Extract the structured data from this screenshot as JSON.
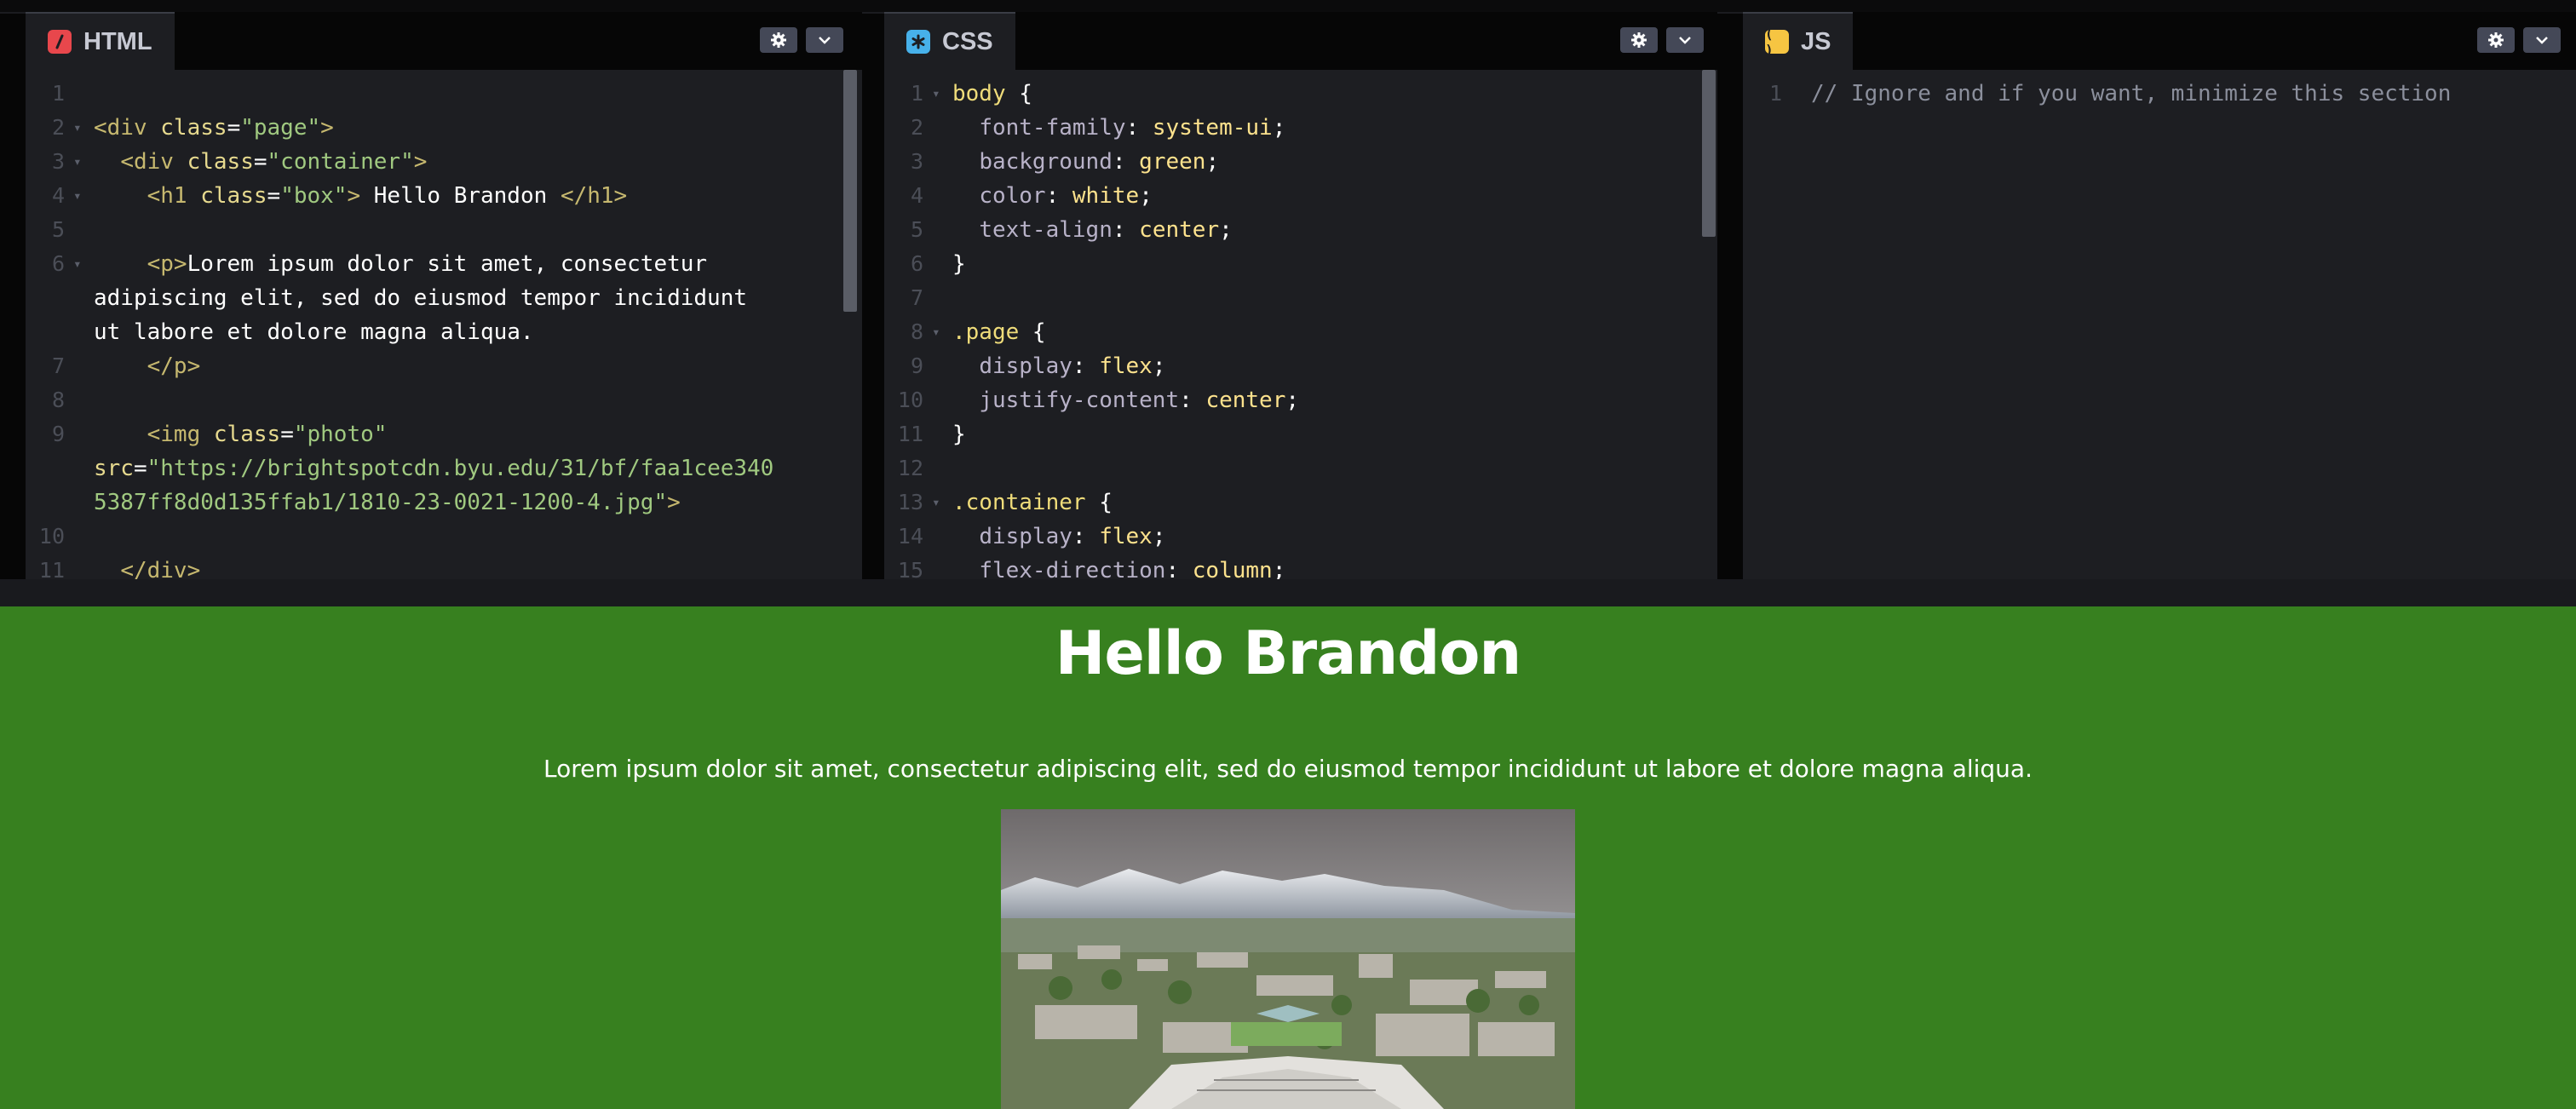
{
  "html_pane": {
    "tab_label": "HTML",
    "icon": "html-slash-icon",
    "lines": [
      {
        "n": "1",
        "fold": false,
        "parts": []
      },
      {
        "n": "2",
        "fold": true,
        "parts": [
          [
            "tag",
            "<div "
          ],
          [
            "attr",
            "class"
          ],
          [
            "punc",
            "="
          ],
          [
            "str",
            "\"page\""
          ],
          [
            "tag",
            ">"
          ]
        ]
      },
      {
        "n": "3",
        "fold": true,
        "parts": [
          [
            "white",
            "  "
          ],
          [
            "tag",
            "<div "
          ],
          [
            "attr",
            "class"
          ],
          [
            "punc",
            "="
          ],
          [
            "str",
            "\"container\""
          ],
          [
            "tag",
            ">"
          ]
        ]
      },
      {
        "n": "4",
        "fold": true,
        "parts": [
          [
            "white",
            "    "
          ],
          [
            "tag",
            "<h1 "
          ],
          [
            "attr",
            "class"
          ],
          [
            "punc",
            "="
          ],
          [
            "str",
            "\"box\""
          ],
          [
            "tag",
            ">"
          ],
          [
            "white",
            " Hello Brandon "
          ],
          [
            "tag",
            "</h1>"
          ]
        ]
      },
      {
        "n": "5",
        "fold": false,
        "parts": []
      },
      {
        "n": "6",
        "fold": true,
        "parts": [
          [
            "white",
            "    "
          ],
          [
            "tag",
            "<p>"
          ],
          [
            "white",
            "Lorem ipsum dolor sit amet, consectetur"
          ]
        ]
      },
      {
        "n": "",
        "fold": false,
        "parts": [
          [
            "white",
            "adipiscing elit, sed do eiusmod tempor incididunt"
          ]
        ]
      },
      {
        "n": "",
        "fold": false,
        "parts": [
          [
            "white",
            "ut labore et dolore magna aliqua."
          ]
        ]
      },
      {
        "n": "7",
        "fold": false,
        "parts": [
          [
            "white",
            "    "
          ],
          [
            "tag",
            "</p>"
          ]
        ]
      },
      {
        "n": "8",
        "fold": false,
        "parts": []
      },
      {
        "n": "9",
        "fold": false,
        "parts": [
          [
            "white",
            "    "
          ],
          [
            "tag",
            "<img "
          ],
          [
            "attr",
            "class"
          ],
          [
            "punc",
            "="
          ],
          [
            "str",
            "\"photo\""
          ]
        ]
      },
      {
        "n": "",
        "fold": false,
        "parts": [
          [
            "attr",
            "src"
          ],
          [
            "punc",
            "="
          ],
          [
            "str",
            "\"https://brightspotcdn.byu.edu/31/bf/faa1cee340"
          ]
        ]
      },
      {
        "n": "",
        "fold": false,
        "parts": [
          [
            "str",
            "5387ff8d0d135ffab1/1810-23-0021-1200-4.jpg\""
          ],
          [
            "tag",
            ">"
          ]
        ]
      },
      {
        "n": "10",
        "fold": false,
        "parts": []
      },
      {
        "n": "11",
        "fold": false,
        "parts": [
          [
            "white",
            "  "
          ],
          [
            "tag",
            "</div>"
          ]
        ]
      }
    ]
  },
  "css_pane": {
    "tab_label": "CSS",
    "icon": "asterisk-icon",
    "lines": [
      {
        "n": "1",
        "fold": true,
        "parts": [
          [
            "sel",
            "body "
          ],
          [
            "punc",
            "{"
          ]
        ]
      },
      {
        "n": "2",
        "fold": false,
        "parts": [
          [
            "white",
            "  "
          ],
          [
            "prop",
            "font-family"
          ],
          [
            "punc",
            ": "
          ],
          [
            "val",
            "system-ui"
          ],
          [
            "punc",
            ";"
          ]
        ]
      },
      {
        "n": "3",
        "fold": false,
        "parts": [
          [
            "white",
            "  "
          ],
          [
            "prop",
            "background"
          ],
          [
            "punc",
            ": "
          ],
          [
            "val",
            "green"
          ],
          [
            "punc",
            ";"
          ]
        ]
      },
      {
        "n": "4",
        "fold": false,
        "parts": [
          [
            "white",
            "  "
          ],
          [
            "prop",
            "color"
          ],
          [
            "punc",
            ": "
          ],
          [
            "val",
            "white"
          ],
          [
            "punc",
            ";"
          ]
        ]
      },
      {
        "n": "5",
        "fold": false,
        "parts": [
          [
            "white",
            "  "
          ],
          [
            "prop",
            "text-align"
          ],
          [
            "punc",
            ": "
          ],
          [
            "val",
            "center"
          ],
          [
            "punc",
            ";"
          ]
        ]
      },
      {
        "n": "6",
        "fold": false,
        "parts": [
          [
            "punc",
            "}"
          ]
        ]
      },
      {
        "n": "7",
        "fold": false,
        "parts": []
      },
      {
        "n": "8",
        "fold": true,
        "parts": [
          [
            "sel",
            ".page "
          ],
          [
            "punc",
            "{"
          ]
        ]
      },
      {
        "n": "9",
        "fold": false,
        "parts": [
          [
            "white",
            "  "
          ],
          [
            "prop",
            "display"
          ],
          [
            "punc",
            ": "
          ],
          [
            "val",
            "flex"
          ],
          [
            "punc",
            ";"
          ]
        ]
      },
      {
        "n": "10",
        "fold": false,
        "parts": [
          [
            "white",
            "  "
          ],
          [
            "prop",
            "justify-content"
          ],
          [
            "punc",
            ": "
          ],
          [
            "val",
            "center"
          ],
          [
            "punc",
            ";"
          ]
        ]
      },
      {
        "n": "11",
        "fold": false,
        "parts": [
          [
            "punc",
            "}"
          ]
        ]
      },
      {
        "n": "12",
        "fold": false,
        "parts": []
      },
      {
        "n": "13",
        "fold": true,
        "parts": [
          [
            "sel",
            ".container "
          ],
          [
            "punc",
            "{"
          ]
        ]
      },
      {
        "n": "14",
        "fold": false,
        "parts": [
          [
            "white",
            "  "
          ],
          [
            "prop",
            "display"
          ],
          [
            "punc",
            ": "
          ],
          [
            "val",
            "flex"
          ],
          [
            "punc",
            ";"
          ]
        ]
      },
      {
        "n": "15",
        "fold": false,
        "parts": [
          [
            "white",
            "  "
          ],
          [
            "prop",
            "flex-direction"
          ],
          [
            "punc",
            ": "
          ],
          [
            "val",
            "column"
          ],
          [
            "punc",
            ";"
          ]
        ]
      }
    ]
  },
  "js_pane": {
    "tab_label": "JS",
    "icon": "braces-icon",
    "lines": [
      {
        "n": "1",
        "fold": false,
        "parts": [
          [
            "comment",
            "// Ignore and if you want, minimize this section"
          ]
        ]
      }
    ]
  },
  "controls": {
    "settings_icon": "gear-icon",
    "collapse_icon": "chevron-down-icon"
  },
  "preview": {
    "heading": "Hello Brandon",
    "paragraph": "Lorem ipsum dolor sit amet, consectetur adipiscing elit, sed do eiusmod tempor incididunt ut labore et dolore magna aliqua.",
    "image_subject": "aerial-campus-mountains-image"
  },
  "colors": {
    "preview_background": "#37801f",
    "editor_background": "#1d1e22",
    "html_icon": "#e8474c",
    "css_icon": "#47b1ea",
    "js_icon": "#f6c542"
  }
}
